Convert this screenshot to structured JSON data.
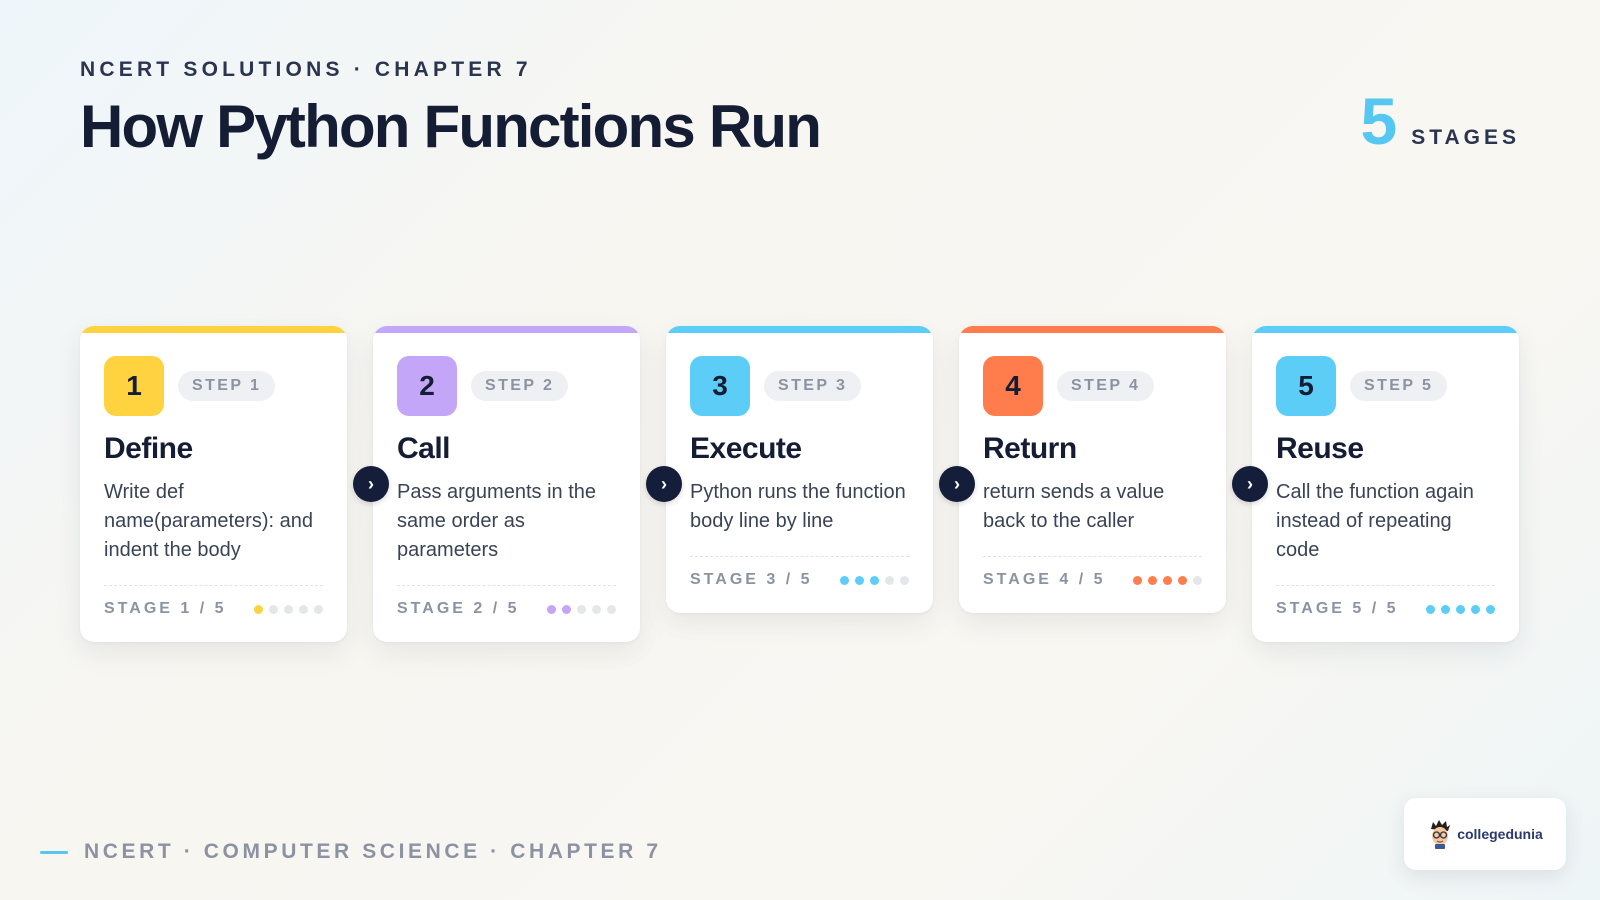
{
  "header": {
    "kicker": "NCERT SOLUTIONS · CHAPTER 7",
    "title": "How Python Functions Run",
    "stages_count": "5",
    "stages_label": "STAGES"
  },
  "steps": [
    {
      "number": "1",
      "step_label": "STEP 1",
      "title": "Define",
      "description": "Write def name(parameters): and indent the body",
      "stage_label": "STAGE 1 / 5",
      "progress": 1,
      "color": "#ffd23f"
    },
    {
      "number": "2",
      "step_label": "STEP 2",
      "title": "Call",
      "description": "Pass arguments in the same order as parameters",
      "stage_label": "STAGE 2 / 5",
      "progress": 2,
      "color": "#c3a6f7"
    },
    {
      "number": "3",
      "step_label": "STEP 3",
      "title": "Execute",
      "description": "Python runs the function body line by line",
      "stage_label": "STAGE 3 / 5",
      "progress": 3,
      "color": "#5ccdf7"
    },
    {
      "number": "4",
      "step_label": "STEP 4",
      "title": "Return",
      "description": "return sends a value back to the caller",
      "stage_label": "STAGE 4 / 5",
      "progress": 4,
      "color": "#ff7d4d"
    },
    {
      "number": "5",
      "step_label": "STEP 5",
      "title": "Reuse",
      "description": "Call the function again instead of repeating code",
      "stage_label": "STAGE 5 / 5",
      "progress": 5,
      "color": "#5ccdf7"
    }
  ],
  "arrow_icon": "chevron-right-icon",
  "footer": {
    "text": "NCERT · COMPUTER SCIENCE · CHAPTER 7"
  },
  "logo": {
    "text": "collegedunia"
  }
}
